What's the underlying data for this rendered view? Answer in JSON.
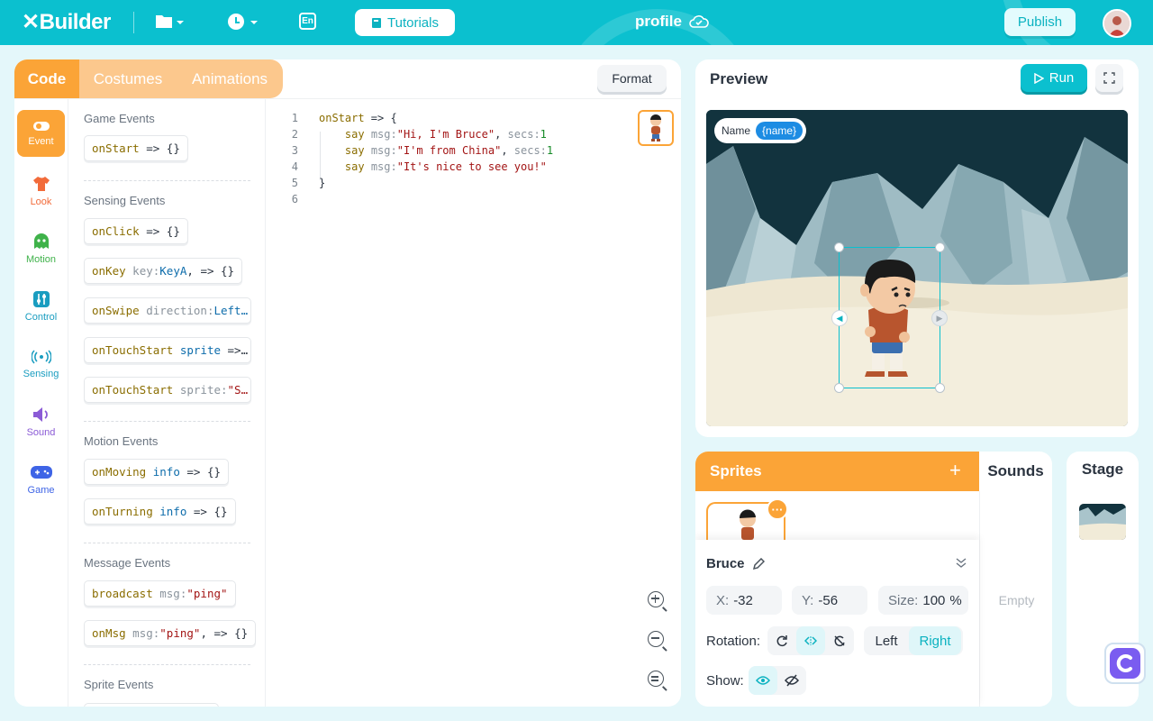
{
  "app": {
    "name": "Builder",
    "project_title": "profile"
  },
  "topbar": {
    "tutorials_label": "Tutorials",
    "publish_label": "Publish",
    "lang_label": "En"
  },
  "code_panel": {
    "tabs": [
      "Code",
      "Costumes",
      "Animations"
    ],
    "format_label": "Format",
    "categories": [
      "Event",
      "Look",
      "Motion",
      "Control",
      "Sensing",
      "Sound",
      "Game"
    ],
    "sections": {
      "game_events": "Game Events",
      "sensing_events": "Sensing Events",
      "motion_events": "Motion Events",
      "message_events": "Message Events",
      "sprite_events": "Sprite Events"
    },
    "blocks": {
      "onstart": {
        "kw": "onStart",
        "rest": " => {}"
      },
      "onclick": {
        "kw": "onClick",
        "rest": " => {}"
      },
      "onkey": {
        "kw": "onKey",
        "arg": " key:",
        "val": "KeyA",
        "rest": ", => {}"
      },
      "onswipe": {
        "kw": "onSwipe",
        "arg": " direction:",
        "val": "Left…"
      },
      "ontouch1": {
        "kw": "onTouchStart",
        "val": " sprite",
        "rest": " =>…"
      },
      "ontouch2": {
        "kw": "onTouchStart",
        "arg": " sprite:",
        "str": "\"S…"
      },
      "onmoving": {
        "kw": "onMoving",
        "val": " info",
        "rest": " => {}"
      },
      "onturning": {
        "kw": "onTurning",
        "val": " info",
        "rest": " => {}"
      },
      "broadcast": {
        "kw": "broadcast",
        "arg": " msg:",
        "str": "\"ping\""
      },
      "onmsg": {
        "kw": "onMsg",
        "arg": " msg:",
        "str": "\"ping\"",
        "rest": ", => {}"
      }
    },
    "code_lines": {
      "numbers": [
        "1",
        "2",
        "3",
        "4",
        "5",
        "6"
      ],
      "l1": {
        "kw": "onStart",
        "rest": " => {"
      },
      "l2": {
        "indent": "    ",
        "kw": "say",
        "arg1": " msg:",
        "str": "\"Hi, I'm Bruce\"",
        "sep": ", ",
        "arg2": "secs:",
        "num": "1"
      },
      "l3": {
        "indent": "    ",
        "kw": "say",
        "arg1": " msg:",
        "str": "\"I'm from China\"",
        "sep": ", ",
        "arg2": "secs:",
        "num": "1"
      },
      "l4": {
        "indent": "    ",
        "kw": "say",
        "arg1": " msg:",
        "str": "\"It's nice to see you!\""
      },
      "l5": "}"
    }
  },
  "preview": {
    "title": "Preview",
    "run_label": "Run",
    "monitor": {
      "label": "Name",
      "value": "{name}"
    }
  },
  "sprites_panel": {
    "title": "Sprites",
    "sounds_tab": "Sounds",
    "sounds_empty": "Empty",
    "sprite_name": "Bruce",
    "x_label": "X:",
    "x_value": "-32",
    "y_label": "Y:",
    "y_value": "-56",
    "size_label": "Size:",
    "size_value": "100",
    "size_unit": "%",
    "rotation_label": "Rotation:",
    "left_label": "Left",
    "right_label": "Right",
    "show_label": "Show:"
  },
  "stage_panel": {
    "title": "Stage"
  },
  "colors": {
    "accent": "#0bc0cf",
    "orange": "#fba437",
    "active_cat": "#fba437"
  }
}
